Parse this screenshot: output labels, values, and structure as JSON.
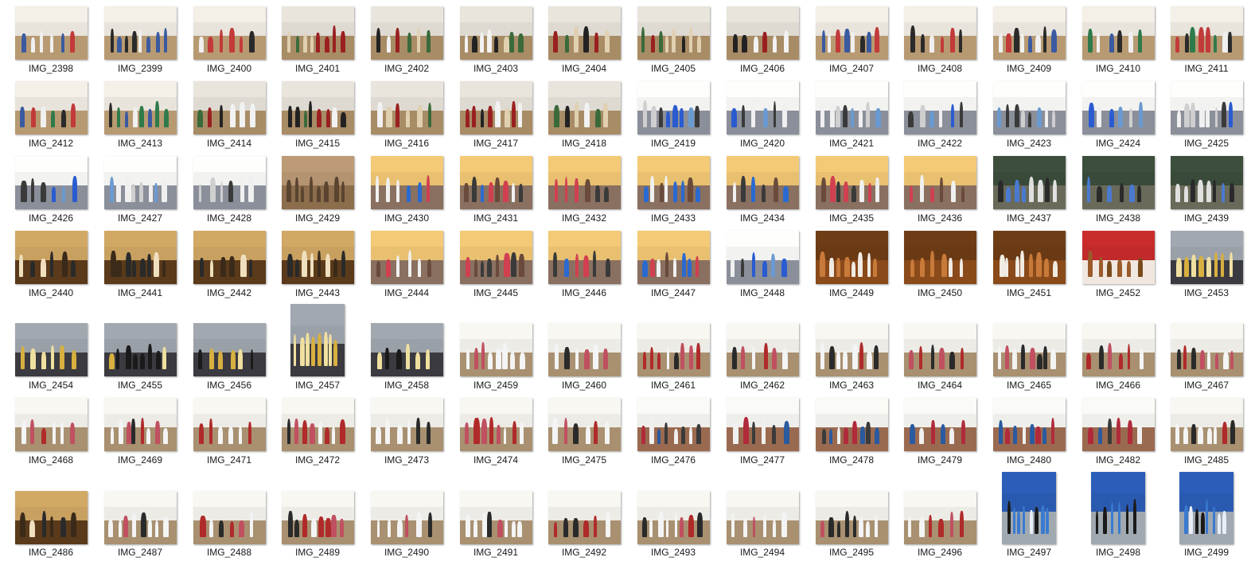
{
  "files": [
    {
      "name": "IMG_2398",
      "palette": "dance-tent"
    },
    {
      "name": "IMG_2399",
      "palette": "dance-tent"
    },
    {
      "name": "IMG_2400",
      "palette": "dance-tent"
    },
    {
      "name": "IMG_2401",
      "palette": "dance-crowd"
    },
    {
      "name": "IMG_2402",
      "palette": "dance-crowd"
    },
    {
      "name": "IMG_2403",
      "palette": "dance-crowd"
    },
    {
      "name": "IMG_2404",
      "palette": "dance-crowd"
    },
    {
      "name": "IMG_2405",
      "palette": "dance-crowd"
    },
    {
      "name": "IMG_2406",
      "palette": "dance-crowd"
    },
    {
      "name": "IMG_2407",
      "palette": "dance-tent"
    },
    {
      "name": "IMG_2408",
      "palette": "dance-tent"
    },
    {
      "name": "IMG_2409",
      "palette": "dance-tent"
    },
    {
      "name": "IMG_2410",
      "palette": "dance-tent"
    },
    {
      "name": "IMG_2411",
      "palette": "dance-tent"
    },
    {
      "name": "IMG_2412",
      "palette": "dance-tent"
    },
    {
      "name": "IMG_2413",
      "palette": "dance-tent"
    },
    {
      "name": "IMG_2414",
      "palette": "dance-crowd"
    },
    {
      "name": "IMG_2415",
      "palette": "dance-crowd"
    },
    {
      "name": "IMG_2416",
      "palette": "dance-crowd"
    },
    {
      "name": "IMG_2417",
      "palette": "dance-crowd"
    },
    {
      "name": "IMG_2418",
      "palette": "dance-crowd"
    },
    {
      "name": "IMG_2419",
      "palette": "kitchen-white"
    },
    {
      "name": "IMG_2420",
      "palette": "kitchen-white"
    },
    {
      "name": "IMG_2421",
      "palette": "kitchen-white"
    },
    {
      "name": "IMG_2422",
      "palette": "kitchen-white"
    },
    {
      "name": "IMG_2423",
      "palette": "kitchen-white"
    },
    {
      "name": "IMG_2424",
      "palette": "kitchen-white"
    },
    {
      "name": "IMG_2425",
      "palette": "kitchen-white"
    },
    {
      "name": "IMG_2426",
      "palette": "kitchen-white"
    },
    {
      "name": "IMG_2427",
      "palette": "kitchen-white"
    },
    {
      "name": "IMG_2428",
      "palette": "kitchen-white"
    },
    {
      "name": "IMG_2429",
      "palette": "sand"
    },
    {
      "name": "IMG_2430",
      "palette": "kitchen-yellow"
    },
    {
      "name": "IMG_2431",
      "palette": "kitchen-yellow"
    },
    {
      "name": "IMG_2432",
      "palette": "kitchen-yellow"
    },
    {
      "name": "IMG_2433",
      "palette": "kitchen-yellow"
    },
    {
      "name": "IMG_2434",
      "palette": "kitchen-yellow"
    },
    {
      "name": "IMG_2435",
      "palette": "kitchen-yellow"
    },
    {
      "name": "IMG_2436",
      "palette": "kitchen-yellow"
    },
    {
      "name": "IMG_2437",
      "palette": "kitchen-green"
    },
    {
      "name": "IMG_2438",
      "palette": "kitchen-green"
    },
    {
      "name": "IMG_2439",
      "palette": "kitchen-green"
    },
    {
      "name": "IMG_2440",
      "palette": "indoor-dark"
    },
    {
      "name": "IMG_2441",
      "palette": "indoor-dark"
    },
    {
      "name": "IMG_2442",
      "palette": "indoor-dark"
    },
    {
      "name": "IMG_2443",
      "palette": "indoor-dark"
    },
    {
      "name": "IMG_2444",
      "palette": "kitchen-yellow"
    },
    {
      "name": "IMG_2445",
      "palette": "kitchen-yellow"
    },
    {
      "name": "IMG_2446",
      "palette": "kitchen-yellow"
    },
    {
      "name": "IMG_2447",
      "palette": "kitchen-yellow"
    },
    {
      "name": "IMG_2448",
      "palette": "kitchen-white"
    },
    {
      "name": "IMG_2449",
      "palette": "food"
    },
    {
      "name": "IMG_2450",
      "palette": "food"
    },
    {
      "name": "IMG_2451",
      "palette": "food"
    },
    {
      "name": "IMG_2452",
      "palette": "food-red"
    },
    {
      "name": "IMG_2453",
      "palette": "pan"
    },
    {
      "name": "IMG_2454",
      "palette": "pan"
    },
    {
      "name": "IMG_2455",
      "palette": "pan"
    },
    {
      "name": "IMG_2456",
      "palette": "pan"
    },
    {
      "name": "IMG_2457",
      "palette": "pan"
    },
    {
      "name": "IMG_2458",
      "palette": "pan"
    },
    {
      "name": "IMG_2459",
      "palette": "dance-white"
    },
    {
      "name": "IMG_2460",
      "palette": "dance-white"
    },
    {
      "name": "IMG_2461",
      "palette": "dance-white"
    },
    {
      "name": "IMG_2462",
      "palette": "dance-white"
    },
    {
      "name": "IMG_2463",
      "palette": "dance-white"
    },
    {
      "name": "IMG_2464",
      "palette": "dance-white"
    },
    {
      "name": "IMG_2465",
      "palette": "dance-white"
    },
    {
      "name": "IMG_2466",
      "palette": "dance-white"
    },
    {
      "name": "IMG_2467",
      "palette": "dance-white"
    },
    {
      "name": "IMG_2468",
      "palette": "dance-white"
    },
    {
      "name": "IMG_2469",
      "palette": "dance-white"
    },
    {
      "name": "IMG_2471",
      "palette": "dance-white"
    },
    {
      "name": "IMG_2472",
      "palette": "dance-white"
    },
    {
      "name": "IMG_2473",
      "palette": "dance-white"
    },
    {
      "name": "IMG_2474",
      "palette": "dance-white"
    },
    {
      "name": "IMG_2475",
      "palette": "dance-white"
    },
    {
      "name": "IMG_2476",
      "palette": "banner"
    },
    {
      "name": "IMG_2477",
      "palette": "banner"
    },
    {
      "name": "IMG_2478",
      "palette": "banner"
    },
    {
      "name": "IMG_2479",
      "palette": "banner"
    },
    {
      "name": "IMG_2480",
      "palette": "banner"
    },
    {
      "name": "IMG_2482",
      "palette": "banner"
    },
    {
      "name": "IMG_2485",
      "palette": "dance-white"
    },
    {
      "name": "IMG_2486",
      "palette": "indoor-dark"
    },
    {
      "name": "IMG_2487",
      "palette": "dance-white"
    },
    {
      "name": "IMG_2488",
      "palette": "dance-white"
    },
    {
      "name": "IMG_2489",
      "palette": "dance-white"
    },
    {
      "name": "IMG_2490",
      "palette": "dance-white"
    },
    {
      "name": "IMG_2491",
      "palette": "dance-white"
    },
    {
      "name": "IMG_2492",
      "palette": "dance-white"
    },
    {
      "name": "IMG_2493",
      "palette": "dance-white"
    },
    {
      "name": "IMG_2494",
      "palette": "dance-white"
    },
    {
      "name": "IMG_2495",
      "palette": "dance-white"
    },
    {
      "name": "IMG_2496",
      "palette": "dance-white"
    },
    {
      "name": "IMG_2497",
      "palette": "blue-cook"
    },
    {
      "name": "IMG_2498",
      "palette": "blue-cook"
    },
    {
      "name": "IMG_2499",
      "palette": "blue-cook"
    }
  ],
  "palettes": {
    "dance-tent": {
      "sky": "#e8e4dc",
      "ground": "#b89a72",
      "figs": [
        "#c23a3a",
        "#3a5aa0",
        "#2a2a2a",
        "#f0f0f0",
        "#2f7a4a"
      ]
    },
    "dance-crowd": {
      "sky": "#dedad2",
      "ground": "#a88c66",
      "figs": [
        "#222222",
        "#f2f2f2",
        "#9a2020",
        "#3a6a3a",
        "#e0d0b0"
      ]
    },
    "kitchen-white": {
      "sky": "#f2f2f0",
      "ground": "#8a8f9a",
      "figs": [
        "#2a5bd0",
        "#f0f0f0",
        "#3a3a3a",
        "#6a9ad0",
        "#cfcfcf"
      ]
    },
    "sand": {
      "sky": "#b49470",
      "ground": "#8c6e4c",
      "figs": [
        "#5a4430"
      ]
    },
    "kitchen-yellow": {
      "sky": "#e8c070",
      "ground": "#8a7060",
      "figs": [
        "#2a6ad0",
        "#f0f0f0",
        "#6a4a3a",
        "#d04050",
        "#3a3a3a"
      ]
    },
    "kitchen-green": {
      "sky": "#3a4a3a",
      "ground": "#6a6a5a",
      "figs": [
        "#4a7ad0",
        "#e0e0e0",
        "#2a2a2a"
      ]
    },
    "indoor-dark": {
      "sky": "#c8a060",
      "ground": "#5a3a1a",
      "figs": [
        "#2a2a2a",
        "#f0e0c0",
        "#3a2a1a"
      ]
    },
    "food": {
      "sky": "#6a3a14",
      "ground": "#8a4a1a",
      "figs": [
        "#f0ece4",
        "#c87a3a"
      ]
    },
    "food-red": {
      "sky": "#c02a2a",
      "ground": "#f0e8e0",
      "figs": [
        "#9a5a2a",
        "#7a4a1a"
      ]
    },
    "pan": {
      "sky": "#9aa0a8",
      "ground": "#3a3a40",
      "figs": [
        "#1a1a1a",
        "#f0e0a0",
        "#d8b040"
      ]
    },
    "dance-white": {
      "sky": "#ecebe6",
      "ground": "#a89070",
      "figs": [
        "#f4f4f4",
        "#b02a2a",
        "#2a2a2a",
        "#f4f4f4",
        "#c05060"
      ]
    },
    "banner": {
      "sky": "#eeeeea",
      "ground": "#9a6a50",
      "figs": [
        "#2a5aa0",
        "#b02a3a",
        "#f0f0f0",
        "#3a3a3a"
      ]
    },
    "blue-cook": {
      "sky": "#2a5ab0",
      "ground": "#a0a8b0",
      "figs": [
        "#e8eef8",
        "#1a1a1a",
        "#3a7ad0"
      ]
    }
  }
}
